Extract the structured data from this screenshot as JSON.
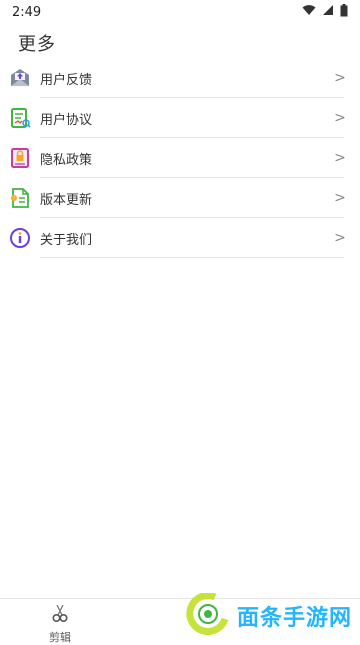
{
  "status": {
    "time": "2:49",
    "icons": [
      "wifi-icon",
      "signal-icon",
      "battery-icon"
    ]
  },
  "page": {
    "title": "更多"
  },
  "menu": [
    {
      "label": "用户反馈",
      "icon": "feedback-icon"
    },
    {
      "label": "用户协议",
      "icon": "agreement-icon"
    },
    {
      "label": "隐私政策",
      "icon": "privacy-icon"
    },
    {
      "label": "版本更新",
      "icon": "update-icon"
    },
    {
      "label": "关于我们",
      "icon": "info-icon"
    }
  ],
  "bottom": {
    "tab_label": "剪辑",
    "watermark_text": "面条手游网"
  },
  "colors": {
    "accent_purple": "#6b3fe0",
    "green": "#3fb63f",
    "watermark_blue": "#25b4ff",
    "watermark_lime": "#c6e33a"
  }
}
